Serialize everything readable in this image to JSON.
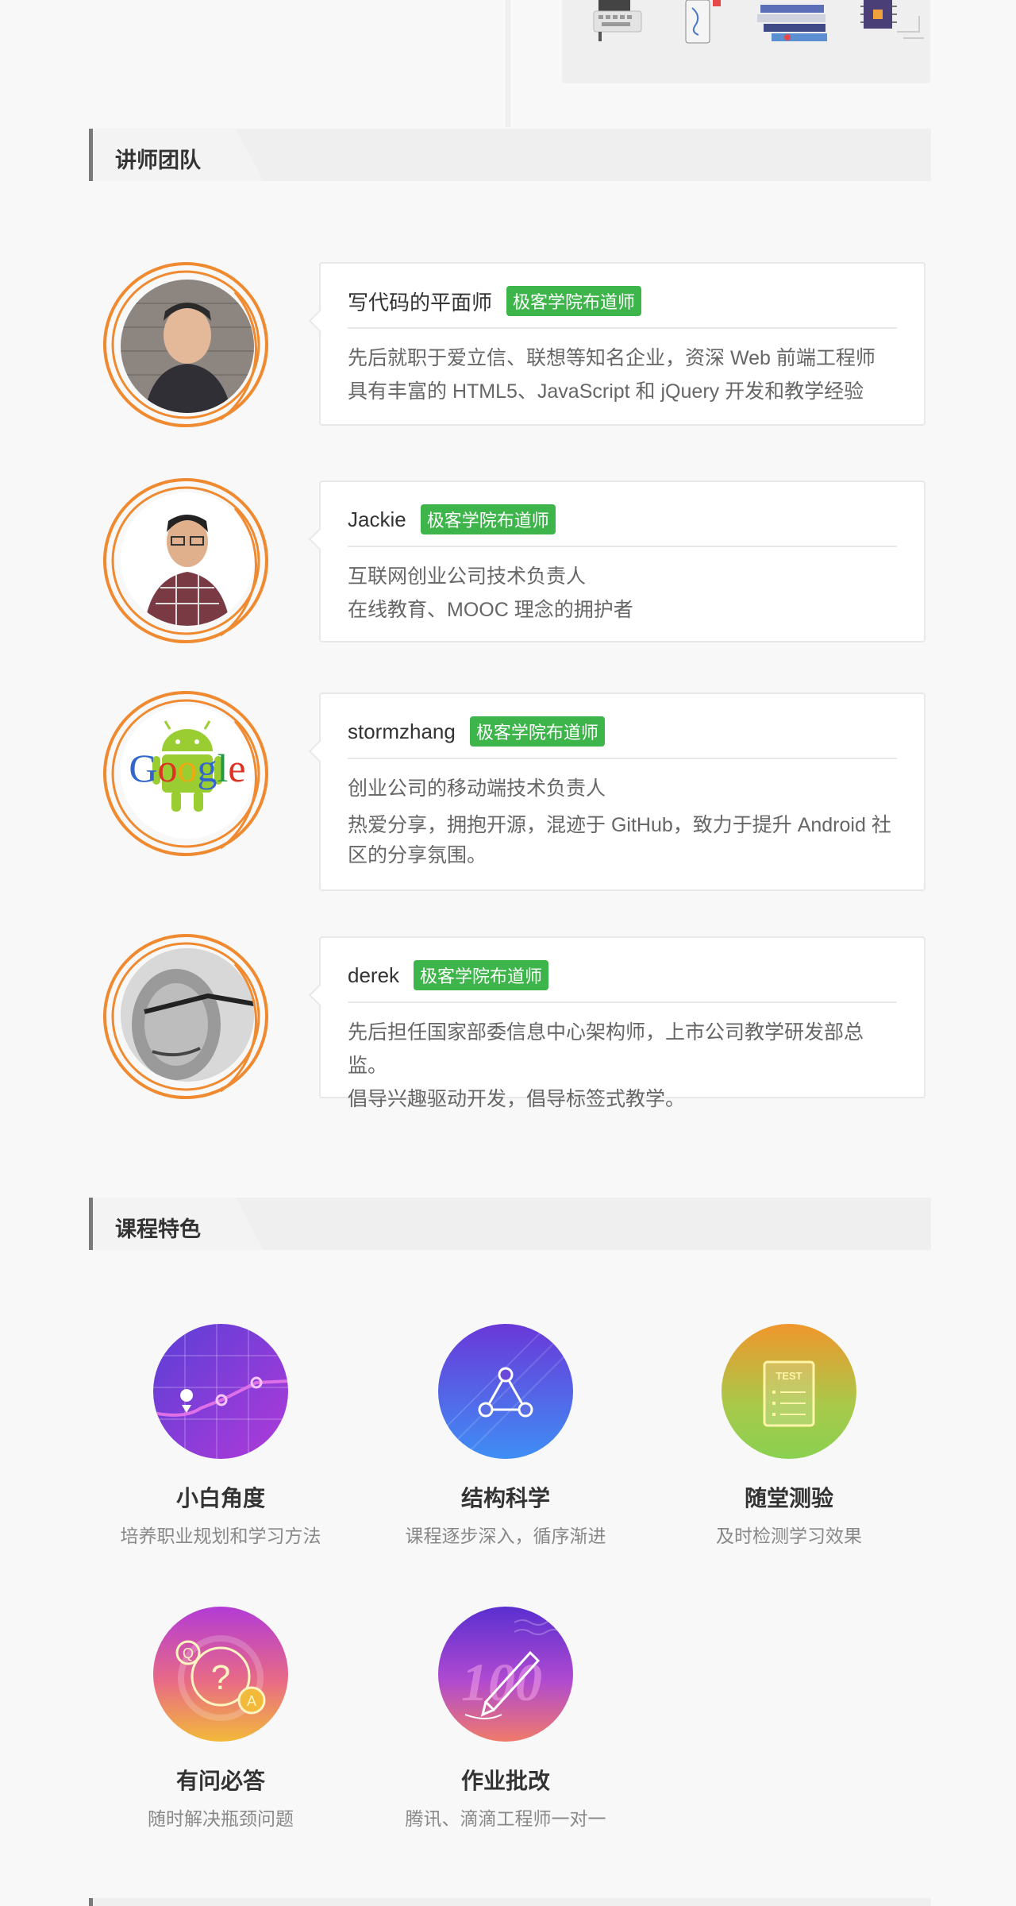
{
  "sections": {
    "teachers_title": "讲师团队",
    "features_title": "课程特色"
  },
  "teachers": [
    {
      "name": "写代码的平面师",
      "badge": "极客学院布道师",
      "lines": [
        "先后就职于爱立信、联想等知名企业，资深 Web 前端工程师",
        "具有丰富的 HTML5、JavaScript 和 jQuery 开发和教学经验"
      ]
    },
    {
      "name": "Jackie",
      "badge": "极客学院布道师",
      "lines": [
        "互联网创业公司技术负责人",
        "在线教育、MOOC 理念的拥护者"
      ]
    },
    {
      "name": "stormzhang",
      "badge": "极客学院布道师",
      "lines": [
        "创业公司的移动端技术负责人",
        "热爱分享，拥抱开源，混迹于 GitHub，致力于提升 Android 社区的分享氛围。"
      ]
    },
    {
      "name": "derek",
      "badge": "极客学院布道师",
      "lines": [
        "先后担任国家部委信息中心架构师，上市公司教学研发部总监。",
        "倡导兴趣驱动开发，倡导标签式教学。"
      ]
    }
  ],
  "google_logo": "Google",
  "features": [
    {
      "title": "小白角度",
      "subtitle": "培养职业规划和学习方法",
      "icon": "map-path-icon"
    },
    {
      "title": "结构科学",
      "subtitle": "课程逐步深入，循序渐进",
      "icon": "triangle-nodes-icon"
    },
    {
      "title": "随堂测验",
      "subtitle": "及时检测学习效果",
      "icon": "test-sheet-icon"
    },
    {
      "title": "有问必答",
      "subtitle": "随时解决瓶颈问题",
      "icon": "qa-bubbles-icon"
    },
    {
      "title": "作业批改",
      "subtitle": "腾讯、滴滴工程师一对一",
      "icon": "pen-score-icon"
    }
  ],
  "colors": {
    "accent_orange": "#f08a30",
    "badge_green": "#3db54a",
    "header_bar": "#7a7a7a"
  }
}
